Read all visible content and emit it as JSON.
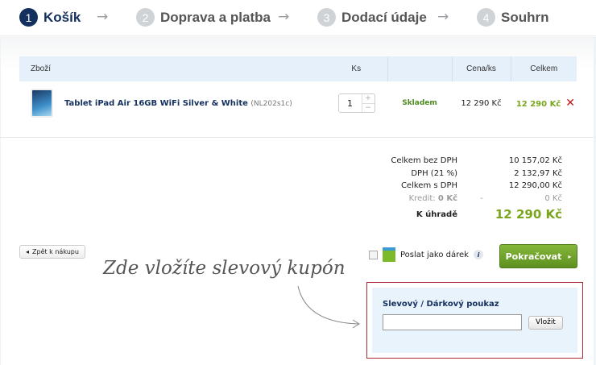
{
  "steps": [
    {
      "num": "1",
      "label": "Košík"
    },
    {
      "num": "2",
      "label": "Doprava a platba"
    },
    {
      "num": "3",
      "label": "Dodací údaje"
    },
    {
      "num": "4",
      "label": "Souhrn"
    }
  ],
  "table": {
    "headers": {
      "item": "Zboží",
      "qty": "Ks",
      "price": "Cena/ks",
      "total": "Celkem"
    },
    "rows": [
      {
        "name": "Tablet iPad Air 16GB WiFi Silver & White",
        "code": "(NL202s1c)",
        "qty": "1",
        "stock": "Skladem",
        "price": "12 290 Kč",
        "total": "12 290 Kč"
      }
    ]
  },
  "totals": {
    "no_vat_label": "Celkem bez DPH",
    "no_vat": "10 157,02 Kč",
    "vat_label": "DPH (21 %)",
    "vat": "2 132,97 Kč",
    "with_vat_label": "Celkem s DPH",
    "with_vat": "12 290,00 Kč",
    "credit_label": "Kredit:",
    "credit_amount": "0 Kč",
    "credit_dash": "-",
    "credit_value": "0 Kč",
    "pay_label": "K úhradě",
    "pay": "12 290 Kč"
  },
  "back_label": "Zpět k nákupu",
  "note": "Zde vložíte slevový kupón",
  "gift_label": "Poslat jako dárek",
  "continue_label": "Pokračovat",
  "coupon": {
    "title": "Slevový / Dárkový poukaz",
    "value": "",
    "button": "Vložit"
  },
  "colors": {
    "accent": "#14305e",
    "green": "#7aa51c",
    "highlight": "#a82a33"
  }
}
